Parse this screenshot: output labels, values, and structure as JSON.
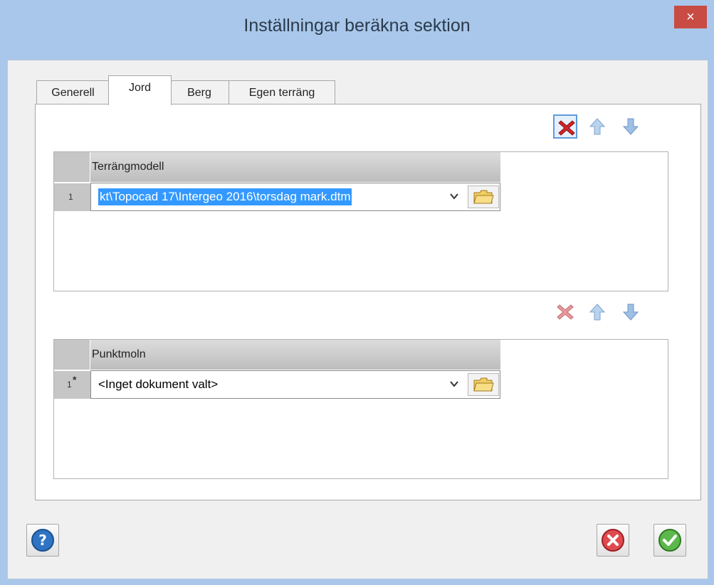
{
  "window": {
    "title": "Inställningar beräkna sektion",
    "close_glyph": "×"
  },
  "tabs": [
    {
      "label": "Generell",
      "active": false
    },
    {
      "label": "Jord",
      "active": true
    },
    {
      "label": "Berg",
      "active": false
    },
    {
      "label": "Egen terräng",
      "active": false
    }
  ],
  "terrain_grid": {
    "toolbar": [
      "delete-icon",
      "move-up-icon",
      "move-down-icon"
    ],
    "column_header": "Terrängmodell",
    "rows": [
      {
        "row_label": "1",
        "value": "kt\\Topocad 17\\Intergeo 2016\\torsdag mark.dtm"
      }
    ]
  },
  "pointcloud_grid": {
    "toolbar": [
      "delete-icon",
      "move-up-icon",
      "move-down-icon"
    ],
    "column_header": "Punktmoln",
    "rows": [
      {
        "row_label": "1",
        "row_marker": "*",
        "value": "<Inget dokument valt>"
      }
    ]
  },
  "footer": {
    "help": "help-icon",
    "cancel": "cancel-icon",
    "ok": "ok-icon"
  },
  "colors": {
    "frame": "#a9c7ea",
    "close": "#c84c43",
    "selection": "#3399ff"
  }
}
